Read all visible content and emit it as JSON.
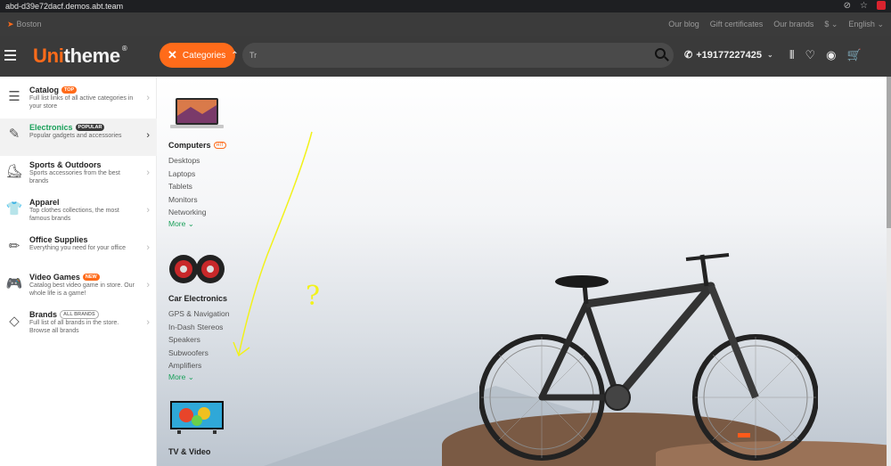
{
  "browser": {
    "url": "abd-d39e72dacf.demos.abt.team"
  },
  "topstrip": {
    "location": "Boston",
    "links": [
      "Our blog",
      "Gift certificates",
      "Our brands",
      "$",
      "English"
    ]
  },
  "header": {
    "logo_first": "Uni",
    "logo_rest": "theme",
    "logo_mark": "®",
    "categories_label": "Categories",
    "search_value": "Tr",
    "phone": "+19177227425"
  },
  "sidebar": {
    "items": [
      {
        "title": "Catalog",
        "badge": "TOP",
        "desc": "Full list links of all active categories in your store",
        "icon": "catalog-list-icon"
      },
      {
        "title": "Electronics",
        "badge": "POPULAR",
        "desc": "Popular gadgets and accessories",
        "icon": "pen-icon"
      },
      {
        "title": "Sports & Outdoors",
        "badge": "",
        "desc": "Sports accessories from the best brands",
        "icon": "skate-icon"
      },
      {
        "title": "Apparel",
        "badge": "",
        "desc": "Top clothes collections, the most famous brands",
        "icon": "tshirt-icon"
      },
      {
        "title": "Office Supplies",
        "badge": "",
        "desc": "Everything you need for your office",
        "icon": "pencil-icon"
      },
      {
        "title": "Video Games",
        "badge": "NEW",
        "desc": "Catalog best video game in store. Our whole life is a game!",
        "icon": "gamepad-icon"
      },
      {
        "title": "Brands",
        "badge": "ALL BRANDS",
        "desc": "Full list of all brands in the store. Browse all brands",
        "icon": "diamond-icon"
      }
    ]
  },
  "submenu": {
    "groups": [
      {
        "title": "Computers",
        "badge": "HIT",
        "links": [
          "Desktops",
          "Laptops",
          "Tablets",
          "Monitors",
          "Networking"
        ],
        "more": "More"
      },
      {
        "title": "Car Electronics",
        "badge": "",
        "links": [
          "GPS & Navigation",
          "In-Dash Stereos",
          "Speakers",
          "Subwoofers",
          "Amplifiers"
        ],
        "more": "More"
      },
      {
        "title": "TV & Video",
        "badge": "",
        "links": [],
        "more": ""
      }
    ]
  },
  "annotation": {
    "mark": "?",
    "color": "#f2f21a"
  },
  "colors": {
    "accent": "#ff6b1a",
    "active_green": "#1aa05a",
    "header_bg": "#3a3a3a"
  }
}
